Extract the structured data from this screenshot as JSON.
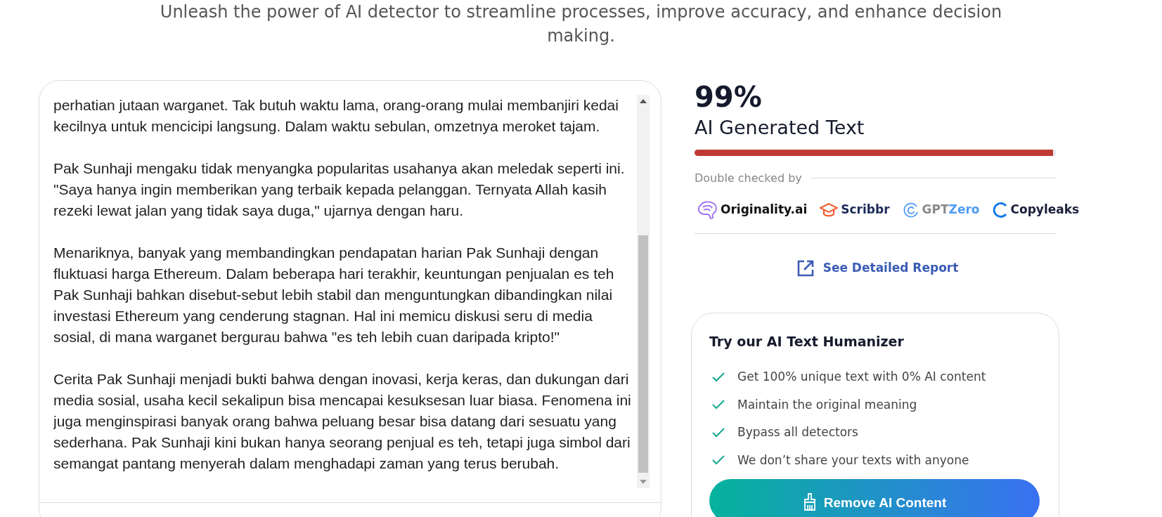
{
  "subtitle": "Unleash the power of AI detector to streamline processes, improve accuracy, and enhance decision making.",
  "editor": {
    "text": "perhatian jutaan warganet. Tak butuh waktu lama, orang-orang mulai membanjiri kedai kecilnya untuk mencicipi langsung. Dalam waktu sebulan, omzetnya meroket tajam.\n\nPak Sunhaji mengaku tidak menyangka popularitas usahanya akan meledak seperti ini. \"Saya hanya ingin memberikan yang terbaik kepada pelanggan. Ternyata Allah kasih rezeki lewat jalan yang tidak saya duga,\" ujarnya dengan haru.\n\nMenariknya, banyak yang membandingkan pendapatan harian Pak Sunhaji dengan fluktuasi harga Ethereum. Dalam beberapa hari terakhir, keuntungan penjualan es teh Pak Sunhaji bahkan disebut-sebut lebih stabil dan menguntungkan dibandingkan nilai investasi Ethereum yang cenderung stagnan. Hal ini memicu diskusi seru di media sosial, di mana warganet bergurau bahwa \"es teh lebih cuan daripada kripto!\"\n\nCerita Pak Sunhaji menjadi bukti bahwa dengan inovasi, kerja keras, dan dukungan dari media sosial, usaha kecil sekalipun bisa mencapai kesuksesan luar biasa. Fenomena ini juga menginspirasi banyak orang bahwa peluang besar bisa datang dari sesuatu yang sederhana. Pak Sunhaji kini bukan hanya seorang penjual es teh, tetapi juga simbol dari semangat pantang menyerah dalam menghadapi zaman yang terus berubah."
  },
  "result": {
    "score": "99%",
    "label": "AI Generated Text",
    "level": 0.99
  },
  "checked_by": {
    "label": "Double checked by",
    "logos": [
      {
        "kind": "brain",
        "parts": [
          {
            "text": "Originality.ai",
            "color": "#111111"
          }
        ]
      },
      {
        "kind": "cap",
        "parts": [
          {
            "text": "Scribbr",
            "color": "#1c2a5a"
          }
        ]
      },
      {
        "kind": "target",
        "parts": [
          {
            "text": "GPT",
            "color": "#8a8a8a"
          },
          {
            "text": "Zero",
            "color": "#4f9cf5"
          }
        ]
      },
      {
        "kind": "ring",
        "parts": [
          {
            "text": "Copyleaks",
            "color": "#1a1f3a"
          }
        ]
      }
    ]
  },
  "report_link": "See Detailed Report",
  "humanizer": {
    "title": "Try our AI Text Humanizer",
    "features": [
      "Get 100% unique text with 0% AI content",
      "Maintain the original meaning",
      "Bypass all detectors",
      "We don’t share your texts with anyone"
    ],
    "button": "Remove AI Content"
  }
}
